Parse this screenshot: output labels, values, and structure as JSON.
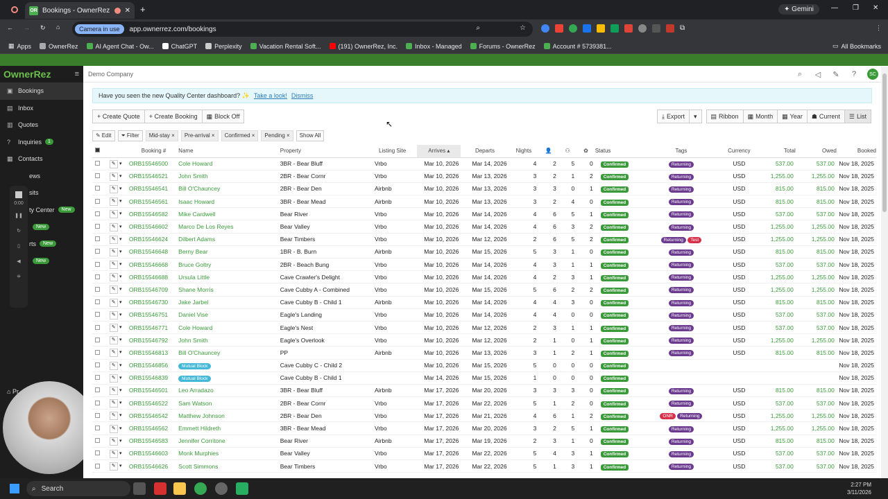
{
  "browser": {
    "tab_title": "Bookings - OwnerRez",
    "camera_chip": "Camera in use",
    "url": "app.ownerrez.com/bookings",
    "profile": "Gemini",
    "bookmarks": [
      "Apps",
      "OwnerRez",
      "AI Agent Chat - Ow...",
      "ChatGPT",
      "Perplexity",
      "Vacation Rental Soft...",
      "(191) OwnerRez, Inc.",
      "Inbox - Managed",
      "Forums - OwnerRez",
      "Account # 5739381..."
    ],
    "all_bookmarks": "All Bookmarks"
  },
  "sidebar": {
    "logo": "OwnerRez",
    "items": [
      {
        "label": "Bookings",
        "icon": "briefcase-icon"
      },
      {
        "label": "Inbox",
        "icon": "inbox-icon"
      },
      {
        "label": "Quotes",
        "icon": "document-icon"
      },
      {
        "label": "Inquiries",
        "icon": "question-icon",
        "count": "1"
      },
      {
        "label": "Contacts",
        "icon": "contacts-icon"
      },
      {
        "label": "ews",
        "icon": "star-icon"
      },
      {
        "label": "sits",
        "icon": "door-icon"
      },
      {
        "label": "ty Center",
        "icon": "grid-icon",
        "badge": "New"
      },
      {
        "label": "",
        "icon": "grid-icon",
        "badge": "New"
      },
      {
        "label": "rts",
        "icon": "chart-icon",
        "badge": "New"
      },
      {
        "label": "",
        "icon": "grid-icon",
        "badge": "New"
      }
    ],
    "recorder_time": "0:00",
    "bottom_label": "Pr"
  },
  "header": {
    "company": "Demo Company",
    "avatar": "SC"
  },
  "banner": {
    "text": "Have you seen the new Quality Center dashboard? ✨",
    "link": "Take a look!",
    "dismiss": "Dismiss"
  },
  "toolbar": {
    "create_quote": "+ Create Quote",
    "create_booking": "+ Create Booking",
    "block_off": "Block Off",
    "export": "Export",
    "ribbon": "Ribbon",
    "month": "Month",
    "year": "Year",
    "current": "Current",
    "list": "List"
  },
  "filters": {
    "edit": "Edit",
    "filter": "Filter",
    "chips": [
      "Mid-stay ×",
      "Pre-arrival ×",
      "Confirmed ×",
      "Pending ×"
    ],
    "show_all": "Show All"
  },
  "table": {
    "headers": [
      "Booking #",
      "Name",
      "Property",
      "Listing Site",
      "Arrives",
      "Departs",
      "Nights",
      "",
      "",
      "",
      "Status",
      "Tags",
      "Currency",
      "Total",
      "Owed",
      "Booked"
    ],
    "rows": [
      [
        "ORB15546500",
        "Cole Howard",
        "3BR - Bear Bluff",
        "Vrbo",
        "Mar 10, 2026",
        "Mar 14, 2026",
        "4",
        "2",
        "5",
        "0",
        "Confirmed",
        "Returning",
        "USD",
        "537.00",
        "537.00",
        "Nov 18, 2025"
      ],
      [
        "ORB15546521",
        "John Smith",
        "2BR - Bear Cornr",
        "Vrbo",
        "Mar 10, 2026",
        "Mar 13, 2026",
        "3",
        "2",
        "1",
        "2",
        "Confirmed",
        "Returning",
        "USD",
        "1,255.00",
        "1,255.00",
        "Nov 18, 2025"
      ],
      [
        "ORB15546541",
        "Bill O'Chauncey",
        "2BR - Bear Den",
        "Airbnb",
        "Mar 10, 2026",
        "Mar 13, 2026",
        "3",
        "3",
        "0",
        "1",
        "Confirmed",
        "Returning",
        "USD",
        "815.00",
        "815.00",
        "Nov 18, 2025"
      ],
      [
        "ORB15546561",
        "Isaac Howard",
        "3BR - Bear Mead",
        "Airbnb",
        "Mar 10, 2026",
        "Mar 13, 2026",
        "3",
        "2",
        "4",
        "0",
        "Confirmed",
        "Returning",
        "USD",
        "815.00",
        "815.00",
        "Nov 18, 2025"
      ],
      [
        "ORB15546582",
        "Mike Cardwell",
        "Bear River",
        "Vrbo",
        "Mar 10, 2026",
        "Mar 14, 2026",
        "4",
        "6",
        "5",
        "1",
        "Confirmed",
        "Returning",
        "USD",
        "537.00",
        "537.00",
        "Nov 18, 2025"
      ],
      [
        "ORB15546602",
        "Marco De Los Reyes",
        "Bear Valley",
        "Vrbo",
        "Mar 10, 2026",
        "Mar 14, 2026",
        "4",
        "6",
        "3",
        "2",
        "Confirmed",
        "Returning",
        "USD",
        "1,255.00",
        "1,255.00",
        "Nov 18, 2025"
      ],
      [
        "ORB15546624",
        "Dilbert Adams",
        "Bear Timbers",
        "Vrbo",
        "Mar 10, 2026",
        "Mar 12, 2026",
        "2",
        "6",
        "5",
        "2",
        "Confirmed",
        "Returning|Test",
        "USD",
        "1,255.00",
        "1,255.00",
        "Nov 18, 2025"
      ],
      [
        "ORB15546648",
        "Berny Bear",
        "1BR - B. Burn",
        "Airbnb",
        "Mar 10, 2026",
        "Mar 15, 2026",
        "5",
        "3",
        "1",
        "0",
        "Confirmed",
        "Returning",
        "USD",
        "815.00",
        "815.00",
        "Nov 18, 2025"
      ],
      [
        "ORB15546668",
        "Bruce Goltry",
        "2BR - Beach Bung",
        "Vrbo",
        "Mar 10, 2026",
        "Mar 14, 2026",
        "4",
        "3",
        "1",
        "1",
        "Confirmed",
        "Returning",
        "USD",
        "537.00",
        "537.00",
        "Nov 18, 2025"
      ],
      [
        "ORB15546688",
        "Ursula Little",
        "Cave Crawler's Delight",
        "Vrbo",
        "Mar 10, 2026",
        "Mar 14, 2026",
        "4",
        "2",
        "3",
        "1",
        "Confirmed",
        "Returning",
        "USD",
        "1,255.00",
        "1,255.00",
        "Nov 18, 2025"
      ],
      [
        "ORB15546709",
        "Shane Morris",
        "Cave Cubby A - Combined",
        "Vrbo",
        "Mar 10, 2026",
        "Mar 15, 2026",
        "5",
        "6",
        "2",
        "2",
        "Confirmed",
        "Returning",
        "USD",
        "1,255.00",
        "1,255.00",
        "Nov 18, 2025"
      ],
      [
        "ORB15546730",
        "Jake Jarbel",
        "Cave Cubby B - Child 1",
        "Airbnb",
        "Mar 10, 2026",
        "Mar 14, 2026",
        "4",
        "4",
        "3",
        "0",
        "Confirmed",
        "Returning",
        "USD",
        "815.00",
        "815.00",
        "Nov 18, 2025"
      ],
      [
        "ORB15546751",
        "Daniel Vise",
        "Eagle's Landing",
        "Vrbo",
        "Mar 10, 2026",
        "Mar 14, 2026",
        "4",
        "4",
        "0",
        "0",
        "Confirmed",
        "Returning",
        "USD",
        "537.00",
        "537.00",
        "Nov 18, 2025"
      ],
      [
        "ORB15546771",
        "Cole Howard",
        "Eagle's Nest",
        "Vrbo",
        "Mar 10, 2026",
        "Mar 12, 2026",
        "2",
        "3",
        "1",
        "1",
        "Confirmed",
        "Returning",
        "USD",
        "537.00",
        "537.00",
        "Nov 18, 2025"
      ],
      [
        "ORB15546792",
        "John Smith",
        "Eagle's Overlook",
        "Vrbo",
        "Mar 10, 2026",
        "Mar 12, 2026",
        "2",
        "1",
        "0",
        "1",
        "Confirmed",
        "Returning",
        "USD",
        "1,255.00",
        "1,255.00",
        "Nov 18, 2025"
      ],
      [
        "ORB15546813",
        "Bill O'Chauncey",
        "PP",
        "Airbnb",
        "Mar 10, 2026",
        "Mar 13, 2026",
        "3",
        "1",
        "2",
        "1",
        "Confirmed",
        "Returning",
        "USD",
        "815.00",
        "815.00",
        "Nov 18, 2025"
      ],
      [
        "ORB15546856",
        "Mutual Block",
        "Cave Cubby C - Child 2",
        "",
        "Mar 10, 2026",
        "Mar 15, 2026",
        "5",
        "0",
        "0",
        "0",
        "Confirmed",
        "",
        "",
        "",
        "",
        "Nov 18, 2025"
      ],
      [
        "ORB15546839",
        "Mutual Block",
        "Cave Cubby B - Child 1",
        "",
        "Mar 14, 2026",
        "Mar 15, 2026",
        "1",
        "0",
        "0",
        "0",
        "Confirmed",
        "",
        "",
        "",
        "",
        "Nov 18, 2025"
      ],
      [
        "ORB15546501",
        "Leo Arradazo",
        "3BR - Bear Bluff",
        "Airbnb",
        "Mar 17, 2026",
        "Mar 20, 2026",
        "3",
        "3",
        "3",
        "0",
        "Confirmed",
        "Returning",
        "USD",
        "815.00",
        "815.00",
        "Nov 18, 2025"
      ],
      [
        "ORB15546522",
        "Sam Watson",
        "2BR - Bear Cornr",
        "Vrbo",
        "Mar 17, 2026",
        "Mar 22, 2026",
        "5",
        "1",
        "2",
        "0",
        "Confirmed",
        "Returning",
        "USD",
        "537.00",
        "537.00",
        "Nov 18, 2025"
      ],
      [
        "ORB15546542",
        "Matthew Johnson",
        "2BR - Bear Den",
        "Vrbo",
        "Mar 17, 2026",
        "Mar 21, 2026",
        "4",
        "6",
        "1",
        "2",
        "Confirmed",
        "ONR|Returning",
        "USD",
        "1,255.00",
        "1,255.00",
        "Nov 18, 2025"
      ],
      [
        "ORB15546562",
        "Emmett Hildreth",
        "3BR - Bear Mead",
        "Vrbo",
        "Mar 17, 2026",
        "Mar 20, 2026",
        "3",
        "2",
        "5",
        "1",
        "Confirmed",
        "Returning",
        "USD",
        "1,255.00",
        "1,255.00",
        "Nov 18, 2025"
      ],
      [
        "ORB15546583",
        "Jennifer Corritone",
        "Bear River",
        "Airbnb",
        "Mar 17, 2026",
        "Mar 19, 2026",
        "2",
        "3",
        "1",
        "0",
        "Confirmed",
        "Returning",
        "USD",
        "815.00",
        "815.00",
        "Nov 18, 2025"
      ],
      [
        "ORB15546603",
        "Monk Murphies",
        "Bear Valley",
        "Vrbo",
        "Mar 17, 2026",
        "Mar 22, 2026",
        "5",
        "4",
        "3",
        "1",
        "Confirmed",
        "Returning",
        "USD",
        "537.00",
        "537.00",
        "Nov 18, 2025"
      ],
      [
        "ORB15546626",
        "Scott Simmons",
        "Bear Timbers",
        "Vrbo",
        "Mar 17, 2026",
        "Mar 22, 2026",
        "5",
        "1",
        "3",
        "1",
        "Confirmed",
        "Returning",
        "USD",
        "537.00",
        "537.00",
        "Nov 18, 2025"
      ]
    ]
  },
  "taskbar": {
    "search": "Search",
    "time": "2:27 PM",
    "date": "3/11/2026"
  }
}
